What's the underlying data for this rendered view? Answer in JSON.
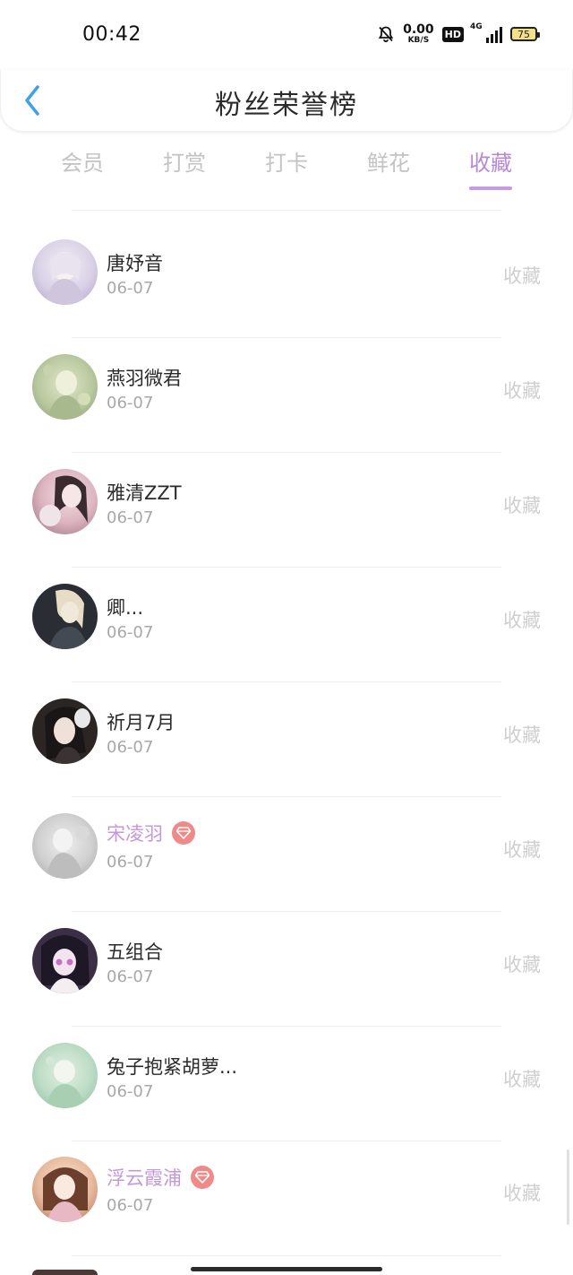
{
  "status_bar": {
    "time": "00:42",
    "net_speed_value": "0.00",
    "net_speed_unit": "KB/S",
    "hd_label": "HD",
    "network_label": "4G",
    "battery_level": "75",
    "icons": [
      "bell-muted-icon",
      "signal-icon",
      "battery-icon"
    ]
  },
  "header": {
    "title": "粉丝荣誉榜",
    "back_icon": "chevron-left-icon"
  },
  "tabs": [
    {
      "label": "会员",
      "active": false
    },
    {
      "label": "打赏",
      "active": false
    },
    {
      "label": "打卡",
      "active": false
    },
    {
      "label": "鲜花",
      "active": false
    },
    {
      "label": "收藏",
      "active": true
    }
  ],
  "colors": {
    "accent": "#b787d8",
    "vip_name": "#c398dd",
    "vip_badge": "#f08a8a",
    "muted_text": "#a8a8a8",
    "back_arrow": "#3ea3e0"
  },
  "fans": [
    {
      "name": "唐妤音",
      "date": "06-07",
      "action": "收藏",
      "vip": false
    },
    {
      "name": "燕羽微君",
      "date": "06-07",
      "action": "收藏",
      "vip": false
    },
    {
      "name": "雅清ZZT",
      "date": "06-07",
      "action": "收藏",
      "vip": false
    },
    {
      "name": "卿...",
      "date": "06-07",
      "action": "收藏",
      "vip": false
    },
    {
      "name": "祈月7月",
      "date": "06-07",
      "action": "收藏",
      "vip": false
    },
    {
      "name": "宋凌羽",
      "date": "06-07",
      "action": "收藏",
      "vip": true
    },
    {
      "name": "五组合",
      "date": "06-07",
      "action": "收藏",
      "vip": false
    },
    {
      "name": "兔子抱紧胡萝...",
      "date": "06-07",
      "action": "收藏",
      "vip": false
    },
    {
      "name": "浮云霞浦",
      "date": "06-07",
      "action": "收藏",
      "vip": true
    }
  ]
}
